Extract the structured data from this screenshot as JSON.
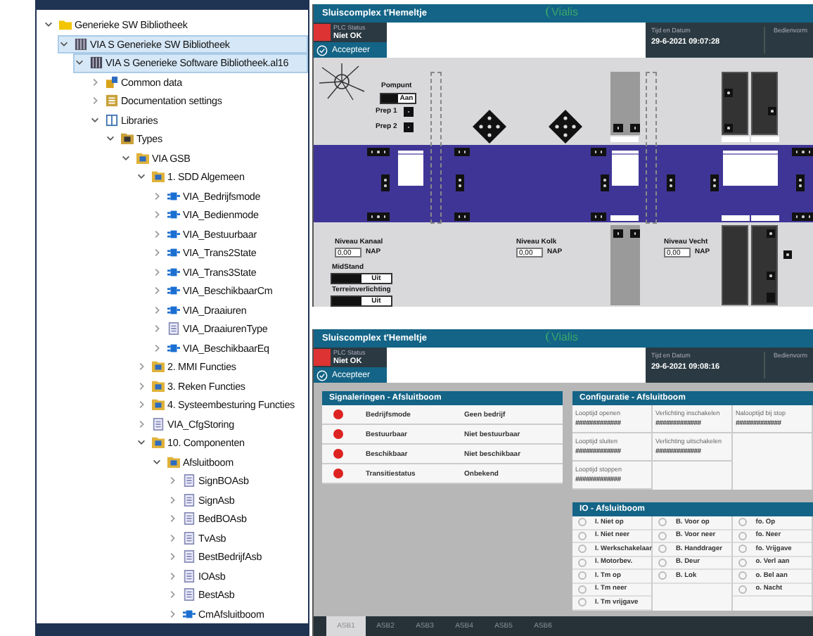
{
  "tree": [
    {
      "label": "Generieke SW Bibliotheek",
      "kind": "folder",
      "expanded": true,
      "selected": false,
      "children": [
        {
          "label": "VIA S Generieke SW Bibliotheek",
          "kind": "project",
          "expanded": true,
          "selected": true,
          "children": [
            {
              "label": "VIA S Generieke Software Bibliotheek.al16",
              "kind": "device",
              "expanded": true,
              "selected": true,
              "children": [
                {
                  "label": "Common data",
                  "kind": "common",
                  "expanded": false,
                  "selected": false
                },
                {
                  "label": "Documentation settings",
                  "kind": "settings",
                  "expanded": false,
                  "selected": false
                },
                {
                  "label": "Libraries",
                  "kind": "book",
                  "expanded": true,
                  "selected": false,
                  "children": [
                    {
                      "label": "Types",
                      "kind": "types",
                      "expanded": true,
                      "selected": false,
                      "children": [
                        {
                          "label": "VIA GSB",
                          "kind": "package",
                          "expanded": true,
                          "selected": false,
                          "children": [
                            {
                              "label": "1. SDD Algemeen",
                              "kind": "package",
                              "expanded": true,
                              "selected": false,
                              "children": [
                                {
                                  "label": "VIA_Bedrijfsmode",
                                  "kind": "block",
                                  "expanded": false,
                                  "selected": false
                                },
                                {
                                  "label": "VIA_Bedienmode",
                                  "kind": "block",
                                  "expanded": false,
                                  "selected": false
                                },
                                {
                                  "label": "VIA_Bestuurbaar",
                                  "kind": "block",
                                  "expanded": false,
                                  "selected": false
                                },
                                {
                                  "label": "VIA_Trans2State",
                                  "kind": "block",
                                  "expanded": false,
                                  "selected": false
                                },
                                {
                                  "label": "VIA_Trans3State",
                                  "kind": "block",
                                  "expanded": false,
                                  "selected": false
                                },
                                {
                                  "label": "VIA_BeschikbaarCm",
                                  "kind": "block",
                                  "expanded": false,
                                  "selected": false
                                },
                                {
                                  "label": "VIA_Draaiuren",
                                  "kind": "block",
                                  "expanded": false,
                                  "selected": false
                                },
                                {
                                  "label": "VIA_DraaiurenType",
                                  "kind": "datatype",
                                  "expanded": false,
                                  "selected": false
                                },
                                {
                                  "label": "VIA_BeschikbaarEq",
                                  "kind": "block",
                                  "expanded": false,
                                  "selected": false
                                }
                              ]
                            },
                            {
                              "label": "2. MMI Functies",
                              "kind": "package",
                              "expanded": false,
                              "selected": false
                            },
                            {
                              "label": "3. Reken Functies",
                              "kind": "package",
                              "expanded": false,
                              "selected": false
                            },
                            {
                              "label": "4. Systeembesturing Functies",
                              "kind": "package",
                              "expanded": false,
                              "selected": false
                            },
                            {
                              "label": "VIA_CfgStoring",
                              "kind": "datatype",
                              "expanded": false,
                              "selected": false
                            },
                            {
                              "label": "10. Componenten",
                              "kind": "package",
                              "expanded": true,
                              "selected": false,
                              "children": [
                                {
                                  "label": "Afsluitboom",
                                  "kind": "package",
                                  "expanded": true,
                                  "selected": false,
                                  "children": [
                                    {
                                      "label": "SignBOAsb",
                                      "kind": "datatype",
                                      "expanded": false,
                                      "selected": false
                                    },
                                    {
                                      "label": "SignAsb",
                                      "kind": "datatype",
                                      "expanded": false,
                                      "selected": false
                                    },
                                    {
                                      "label": "BedBOAsb",
                                      "kind": "datatype",
                                      "expanded": false,
                                      "selected": false
                                    },
                                    {
                                      "label": "TvAsb",
                                      "kind": "datatype",
                                      "expanded": false,
                                      "selected": false
                                    },
                                    {
                                      "label": "BestBedrijfAsb",
                                      "kind": "datatype",
                                      "expanded": false,
                                      "selected": false
                                    },
                                    {
                                      "label": "IOAsb",
                                      "kind": "datatype",
                                      "expanded": false,
                                      "selected": false
                                    },
                                    {
                                      "label": "BestAsb",
                                      "kind": "datatype",
                                      "expanded": false,
                                      "selected": false
                                    },
                                    {
                                      "label": "CmAfsluitboom",
                                      "kind": "block",
                                      "expanded": false,
                                      "selected": false
                                    }
                                  ]
                                }
                              ]
                            }
                          ]
                        }
                      ]
                    }
                  ]
                }
              ]
            }
          ]
        }
      ]
    }
  ],
  "top_screen": {
    "header": {
      "title": "Sluiscomplex t'Hemeltje",
      "logo": "Vialis",
      "plc_label": "PLC Status",
      "plc_status": "Niet OK",
      "accept": "Accepteer",
      "time_label": "Tijd en Datum",
      "time": "29-6-2021 09:07:28",
      "mode_label": "Bedienvorm"
    },
    "synoptic": {
      "pump": {
        "label": "Pompunt",
        "button": "Aan"
      },
      "preps": [
        "Prep 1",
        "Prep 2"
      ],
      "levels": [
        {
          "label": "Niveau Kanaal",
          "value": "0,00",
          "unit": "NAP"
        },
        {
          "label": "Niveau Kolk",
          "value": "0,00",
          "unit": "NAP"
        },
        {
          "label": "Niveau Vecht",
          "value": "0,00",
          "unit": "NAP"
        }
      ],
      "toggles": [
        {
          "label": "MidStand",
          "button": "Uit",
          "on": false
        },
        {
          "label": "Terreinverlichting",
          "button": "Uit",
          "on": false
        }
      ]
    }
  },
  "bottom_screen": {
    "header": {
      "title": "Sluiscomplex t'Hemeltje",
      "logo": "Vialis",
      "plc_label": "PLC Status",
      "plc_status": "Niet OK",
      "accept": "Accepteer",
      "time_label": "Tijd en Datum",
      "time": "29-6-2021 09:08:16",
      "mode_label": "Bedienvorm"
    },
    "signals": {
      "title": "Signaleringen - Afsluitboom",
      "rows": [
        {
          "name": "Bedrijfsmode",
          "value": "Geen bedrijf"
        },
        {
          "name": "Bestuurbaar",
          "value": "Niet bestuurbaar"
        },
        {
          "name": "Beschikbaar",
          "value": "Niet beschikbaar"
        },
        {
          "name": "Transitiestatus",
          "value": "Onbekend"
        }
      ]
    },
    "config": {
      "title": "Configuratie - Afsluitboom",
      "columns": [
        [
          {
            "label": "Looptijd openen",
            "value": "#############"
          },
          {
            "label": "Looptijd sluiten",
            "value": "#############"
          },
          {
            "label": "Looptijd stoppen",
            "value": "#############"
          }
        ],
        [
          {
            "label": "Verlichting inschakelen",
            "value": "#############"
          },
          {
            "label": "Verlichting uitschakelen",
            "value": "#############"
          }
        ],
        [
          {
            "label": "Nalooptijd bij stop",
            "value": "#############"
          }
        ]
      ]
    },
    "io": {
      "title": "IO - Afsluitboom",
      "columns": [
        [
          {
            "label": "I. Niet op",
            "on": false
          },
          {
            "label": "I. Niet neer",
            "on": false
          },
          {
            "label": "I. Werkschakelaar",
            "on": false
          },
          {
            "label": "I. Motorbev.",
            "on": false
          },
          {
            "label": "I. Tm op",
            "on": false
          },
          {
            "label": "I. Tm neer",
            "on": false
          },
          {
            "label": "I. Tm vrijgave",
            "on": false
          }
        ],
        [
          {
            "label": "B. Voor op",
            "on": false
          },
          {
            "label": "B. Voor neer",
            "on": false
          },
          {
            "label": "B. Handdrager",
            "on": false
          },
          {
            "label": "B. Deur",
            "on": false
          },
          {
            "label": "B. Lok",
            "on": false
          }
        ],
        [
          {
            "label": "fo. Op",
            "on": false
          },
          {
            "label": "fo. Neer",
            "on": false
          },
          {
            "label": "fo. Vrijgave",
            "on": false
          },
          {
            "label": "o. Verl aan",
            "on": false
          },
          {
            "label": "o. Bel aan",
            "on": false
          },
          {
            "label": "o. Nacht",
            "on": false
          }
        ]
      ]
    },
    "tabs": [
      {
        "label": "ASB1",
        "selected": true
      },
      {
        "label": "ASB2",
        "selected": false
      },
      {
        "label": "ASB3",
        "selected": false
      },
      {
        "label": "ASB4",
        "selected": false
      },
      {
        "label": "ASB5",
        "selected": false
      },
      {
        "label": "ASB6",
        "selected": false
      }
    ]
  }
}
